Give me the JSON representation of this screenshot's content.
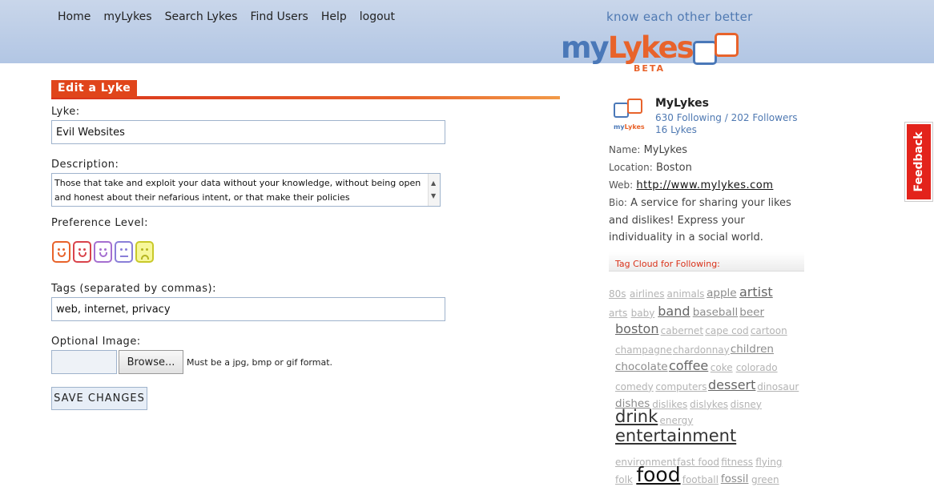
{
  "nav": [
    "Home",
    "myLykes",
    "Search Lykes",
    "Find Users",
    "Help",
    "logout"
  ],
  "tagline": "know each other better",
  "logo": {
    "my": "my",
    "lykes": "Lykes",
    "beta": "BETA",
    "brand_blue": "#4a78b8",
    "brand_orange": "#e8632b"
  },
  "form": {
    "title": "Edit a Lyke",
    "lyke_label": "Lyke:",
    "lyke_value": "Evil Websites",
    "description_label": "Description:",
    "description_value": "Those that take and exploit your data without your knowledge, without being open and honest about their nefarious intent, or that make their policies",
    "preference_label": "Preference Level:",
    "preference_faces": [
      {
        "icon": "smile-face-icon",
        "color": "#e8632b"
      },
      {
        "icon": "smile-face-icon",
        "color": "#d9434b"
      },
      {
        "icon": "smile-face-icon",
        "color": "#a56fd0"
      },
      {
        "icon": "neutral-face-icon",
        "color": "#8a7fd8"
      },
      {
        "icon": "sad-face-icon",
        "color": "#c9c92a"
      }
    ],
    "tags_label": "Tags (separated by commas):",
    "tags_value": "web, internet, privacy",
    "image_label": "Optional Image:",
    "browse_label": "Browse...",
    "file_hint": "Must be a jpg, bmp or gif format.",
    "save_label": "SAVE CHANGES"
  },
  "profile": {
    "avatar_text_my": "my",
    "avatar_text_lykes": "Lykes",
    "name": "MyLykes",
    "following": "630 Following",
    "followers": "202 Followers",
    "lykes_count": "16 Lykes",
    "name_key": "Name:",
    "name_value": "MyLykes",
    "location_key": "Location:",
    "location_value": "Boston",
    "web_key": "Web:",
    "web_value": "http://www.mylykes.com",
    "bio_key": "Bio:",
    "bio_value": "A service for sharing your likes and dislikes! Express your individuality in a social world."
  },
  "tag_cloud": {
    "title": "Tag Cloud for Following:",
    "rows": [
      [
        {
          "t": "80s",
          "s": 1
        },
        {
          "t": "airlines",
          "s": 1
        },
        {
          "t": "animals",
          "s": 1
        },
        {
          "t": "apple",
          "s": 2
        },
        {
          "t": "artist",
          "s": 3
        }
      ],
      [
        {
          "t": "arts",
          "s": 1
        },
        {
          "t": "baby",
          "s": 1
        },
        {
          "t": "band",
          "s": 3
        },
        {
          "t": "baseball",
          "s": 2
        },
        {
          "t": "beer",
          "s": 2
        }
      ],
      [
        {
          "t": "boston",
          "s": 3
        },
        {
          "t": "cabernet",
          "s": 1
        },
        {
          "t": "cape cod",
          "s": 1
        },
        {
          "t": "cartoon",
          "s": 1
        }
      ],
      [
        {
          "t": "champagne",
          "s": 1
        },
        {
          "t": "chardonnay",
          "s": 1
        },
        {
          "t": "children",
          "s": 2
        }
      ],
      [
        {
          "t": "chocolate",
          "s": 2
        },
        {
          "t": "coffee",
          "s": 3
        },
        {
          "t": "coke",
          "s": 1
        },
        {
          "t": "colorado",
          "s": 1
        }
      ],
      [
        {
          "t": "comedy",
          "s": 1
        },
        {
          "t": "computers",
          "s": 1
        },
        {
          "t": "dessert",
          "s": 3
        },
        {
          "t": "dinosaur",
          "s": 1
        }
      ],
      [
        {
          "t": "dishes",
          "s": 2
        },
        {
          "t": "dislikes",
          "s": 1
        },
        {
          "t": "dislykes",
          "s": 1
        },
        {
          "t": "disney",
          "s": 1
        }
      ],
      [
        {
          "t": "drink",
          "s": 4
        },
        {
          "t": "energy",
          "s": 1
        }
      ],
      [
        {
          "t": "entertainment",
          "s": 4
        }
      ],
      [
        {
          "t": "environment",
          "s": 1
        },
        {
          "t": "fast food",
          "s": 1
        },
        {
          "t": "fitness",
          "s": 1
        },
        {
          "t": "flying",
          "s": 1
        }
      ],
      [
        {
          "t": "folk",
          "s": 1
        },
        {
          "t": "food",
          "s": 5
        },
        {
          "t": "football",
          "s": 1
        },
        {
          "t": "fossil",
          "s": 2
        },
        {
          "t": "green",
          "s": 1
        }
      ]
    ]
  },
  "feedback_label": "Feedback"
}
